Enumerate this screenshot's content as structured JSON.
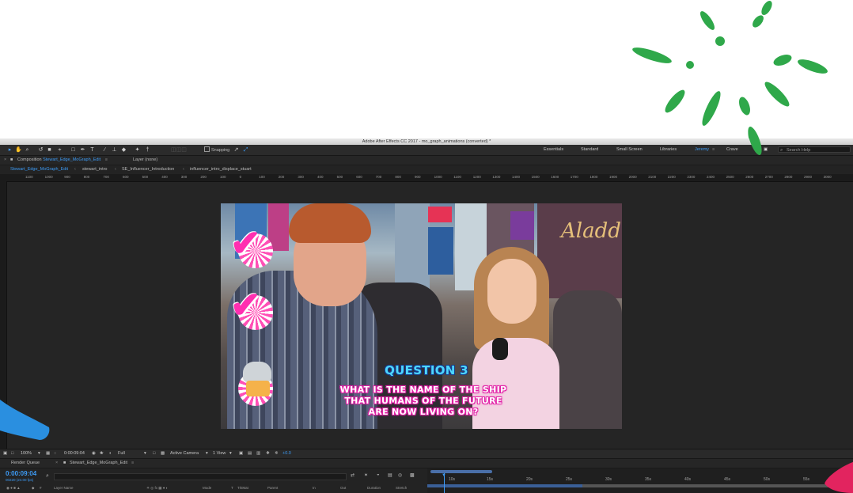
{
  "window": {
    "title": "Adobe After Effects CC 2017 - mo_graph_animations (converted) *"
  },
  "toolbar": {
    "tools": [
      "selection-tool-icon",
      "hand-tool-icon",
      "zoom-tool-icon",
      "rotate-tool-icon",
      "camera-tool-icon",
      "pan-behind-tool-icon",
      "rectangle-tool-icon",
      "pen-tool-icon",
      "type-tool-icon",
      "brush-tool-icon",
      "clone-stamp-tool-icon",
      "eraser-tool-icon",
      "roto-brush-tool-icon",
      "puppet-pin-tool-icon"
    ],
    "snapping_label": "Snapping",
    "workspaces": [
      "Essentials",
      "Standard",
      "Small Screen",
      "Libraries",
      "Jeremy",
      "Crave"
    ],
    "active_workspace": "Jeremy",
    "search_placeholder": "Search Help"
  },
  "panel": {
    "composition_prefix": "Composition",
    "composition_name": "Stewart_Edge_MoGraph_Edit",
    "layer_tab": "Layer (none)"
  },
  "breadcrumbs": [
    "Stewart_Edge_MoGraph_Edit",
    "stewart_intro",
    "SE_Influencer_Introduction",
    "influencer_intro_displace_stuart"
  ],
  "ruler_ticks": [
    "1100",
    "1000",
    "900",
    "800",
    "700",
    "600",
    "500",
    "400",
    "300",
    "200",
    "100",
    "0",
    "100",
    "200",
    "300",
    "400",
    "500",
    "600",
    "700",
    "800",
    "900",
    "1000",
    "1100",
    "1200",
    "1300",
    "1400",
    "1500",
    "1600",
    "1700",
    "1800",
    "1900",
    "2000",
    "2100",
    "2200",
    "2300",
    "2400",
    "2500",
    "2600",
    "2700",
    "2800",
    "2900",
    "3000"
  ],
  "frame": {
    "question_title": "QUESTION 3",
    "question_lines": [
      "WHAT IS THE NAME OF THE SHIP",
      "THAT HUMANS OF THE FUTURE",
      "ARE NOW LIVING ON?"
    ],
    "sign_text": "Aladdin"
  },
  "viewer_controls": {
    "zoom": "100%",
    "timecode": "0:00:09:04",
    "resolution": "Full",
    "camera": "Active Camera",
    "views": "1 View",
    "exposure": "+0.0"
  },
  "timeline": {
    "tabs": [
      "Render Queue",
      "Stewart_Edge_MoGraph_Edit"
    ],
    "current_time": "0:00:09:04",
    "frame_info": "00220 (24.00 fps)",
    "columns": [
      "Layer Name",
      "Mode",
      "T",
      "TrkMat",
      "Parent",
      "In",
      "Out",
      "Duration",
      "Stretch"
    ],
    "ticks": [
      "10s",
      "15s",
      "20s",
      "25s",
      "30s",
      "35s",
      "40s",
      "45s",
      "50s",
      "55s"
    ]
  },
  "colors": {
    "accent": "#3d9bf5",
    "pink": "#ff2fb0",
    "decor_green": "#2fa84a",
    "decor_blue": "#2a8fe0"
  }
}
